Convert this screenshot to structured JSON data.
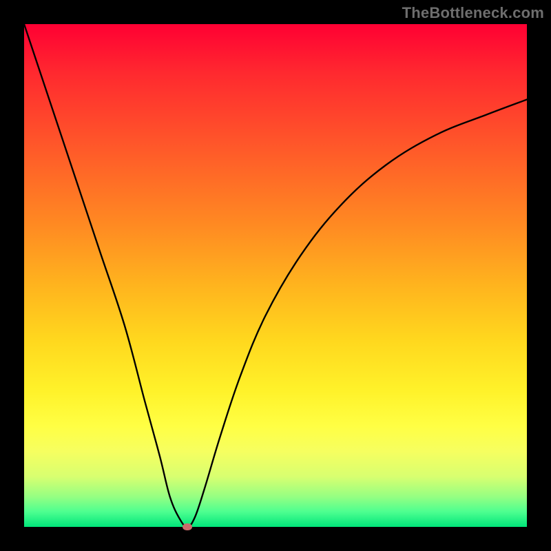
{
  "watermark": "TheBottleneck.com",
  "chart_data": {
    "type": "line",
    "title": "",
    "xlabel": "",
    "ylabel": "",
    "xlim": [
      0,
      100
    ],
    "ylim": [
      0,
      100
    ],
    "grid": false,
    "background_gradient": [
      "#ff0033",
      "#ffb41e",
      "#ffff44",
      "#00e57a"
    ],
    "series": [
      {
        "name": "bottleneck-curve",
        "x": [
          0,
          5,
          10,
          15,
          20,
          24,
          27,
          29,
          31,
          32.5,
          34,
          36,
          39,
          43,
          48,
          55,
          63,
          72,
          82,
          92,
          100
        ],
        "y": [
          100,
          85,
          70,
          55,
          40,
          25,
          14,
          6,
          1.5,
          0,
          2,
          8,
          18,
          30,
          42,
          54,
          64,
          72,
          78,
          82,
          85
        ]
      }
    ],
    "marker": {
      "x": 32.5,
      "y": 0,
      "color": "#cc6b6b"
    }
  }
}
